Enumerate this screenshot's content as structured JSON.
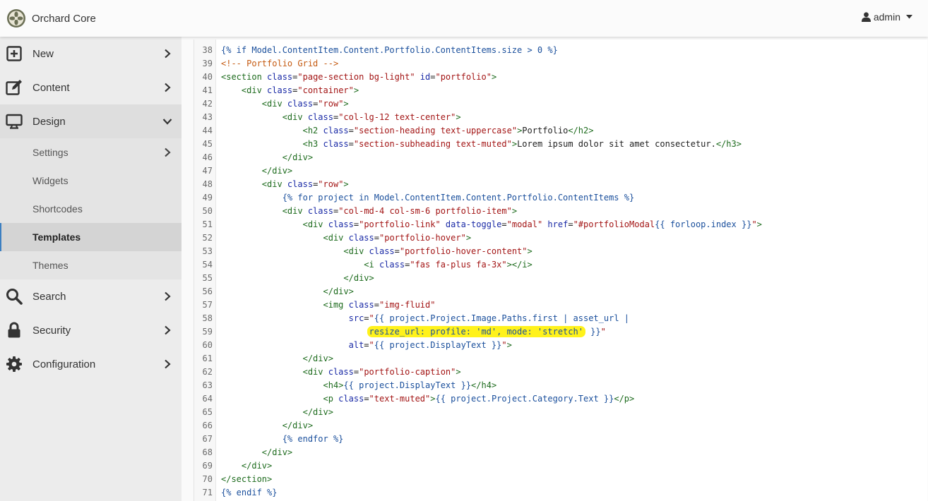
{
  "app": {
    "title": "Orchard Core"
  },
  "user_menu": {
    "label": "admin"
  },
  "sidebar": {
    "items": [
      {
        "label": "New",
        "icon": "plus-square-icon"
      },
      {
        "label": "Content",
        "icon": "edit-icon"
      },
      {
        "label": "Design",
        "icon": "desktop-icon",
        "expanded": true,
        "children": [
          {
            "label": "Settings",
            "has_children": true
          },
          {
            "label": "Widgets"
          },
          {
            "label": "Shortcodes"
          },
          {
            "label": "Templates",
            "current": true
          },
          {
            "label": "Themes"
          }
        ]
      },
      {
        "label": "Search",
        "icon": "search-icon"
      },
      {
        "label": "Security",
        "icon": "lock-icon"
      },
      {
        "label": "Configuration",
        "icon": "gear-icon"
      }
    ]
  },
  "editor": {
    "highlight_color": "#fff21b",
    "lines": [
      {
        "n": "38",
        "text": "{% if Model.ContentItem.Content.Portfolio.ContentItems.size > 0 %}"
      },
      {
        "n": "39",
        "text": "<!-- Portfolio Grid -->"
      },
      {
        "n": "40",
        "text": "<section class=\"page-section bg-light\" id=\"portfolio\">"
      },
      {
        "n": "41",
        "text": "    <div class=\"container\">"
      },
      {
        "n": "42",
        "text": "        <div class=\"row\">"
      },
      {
        "n": "43",
        "text": "            <div class=\"col-lg-12 text-center\">"
      },
      {
        "n": "44",
        "text": "                <h2 class=\"section-heading text-uppercase\">Portfolio</h2>"
      },
      {
        "n": "45",
        "text": "                <h3 class=\"section-subheading text-muted\">Lorem ipsum dolor sit amet consectetur.</h3>"
      },
      {
        "n": "46",
        "text": "            </div>"
      },
      {
        "n": "47",
        "text": "        </div>"
      },
      {
        "n": "48",
        "text": "        <div class=\"row\">"
      },
      {
        "n": "49",
        "text": "            {% for project in Model.ContentItem.Content.Portfolio.ContentItems %}"
      },
      {
        "n": "50",
        "text": "            <div class=\"col-md-4 col-sm-6 portfolio-item\">"
      },
      {
        "n": "51",
        "text": "                <div class=\"portfolio-link\" data-toggle=\"modal\" href=\"#portfolioModal{{ forloop.index }}\">"
      },
      {
        "n": "52",
        "text": "                    <div class=\"portfolio-hover\">"
      },
      {
        "n": "53",
        "text": "                        <div class=\"portfolio-hover-content\">"
      },
      {
        "n": "54",
        "text": "                            <i class=\"fas fa-plus fa-3x\"></i>"
      },
      {
        "n": "55",
        "text": "                        </div>"
      },
      {
        "n": "56",
        "text": "                    </div>"
      },
      {
        "n": "57",
        "text": "                    <img class=\"img-fluid\""
      },
      {
        "n": "58",
        "text": "                         src=\"{{ project.Project.Image.Paths.first | asset_url |"
      },
      {
        "n": "59",
        "text": "                             resize_url: profile: 'md', mode: 'stretch' }}\"",
        "highlight": "resize_url: profile: 'md', mode: 'stretch'"
      },
      {
        "n": "60",
        "text": "                         alt=\"{{ project.DisplayText }}\">"
      },
      {
        "n": "61",
        "text": "                </div>"
      },
      {
        "n": "62",
        "text": "                <div class=\"portfolio-caption\">"
      },
      {
        "n": "63",
        "text": "                    <h4>{{ project.DisplayText }}</h4>"
      },
      {
        "n": "64",
        "text": "                    <p class=\"text-muted\">{{ project.Project.Category.Text }}</p>"
      },
      {
        "n": "65",
        "text": "                </div>"
      },
      {
        "n": "66",
        "text": "            </div>"
      },
      {
        "n": "67",
        "text": "            {% endfor %}"
      },
      {
        "n": "68",
        "text": "        </div>"
      },
      {
        "n": "69",
        "text": "    </div>"
      },
      {
        "n": "70",
        "text": "</section>"
      },
      {
        "n": "71",
        "text": "{% endif %}"
      }
    ]
  }
}
